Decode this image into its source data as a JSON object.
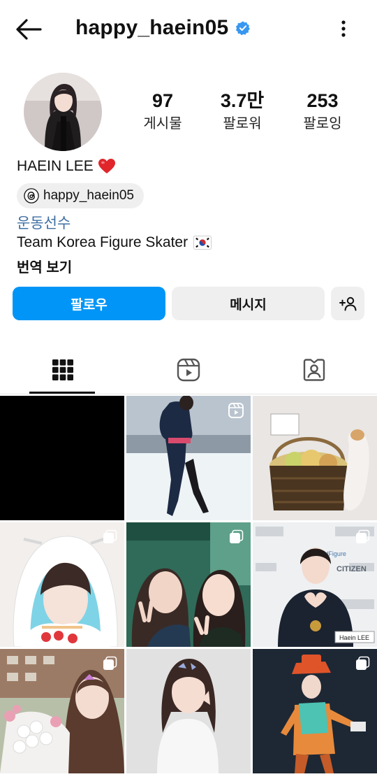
{
  "header": {
    "username": "happy_haein05",
    "verified": true,
    "accent_color": "#3897f0"
  },
  "stats": [
    {
      "value": "97",
      "label": "게시물"
    },
    {
      "value": "3.7만",
      "label": "팔로워"
    },
    {
      "value": "253",
      "label": "팔로잉"
    }
  ],
  "profile": {
    "display_name": "HAEIN LEE",
    "threads_handle": "happy_haein05",
    "category": "운동선수",
    "bio": "Team Korea Figure Skater",
    "translate_label": "번역 보기"
  },
  "actions": {
    "follow_label": "팔로우",
    "message_label": "메시지",
    "follow_color": "#0095f6"
  },
  "tabs": [
    {
      "name": "posts-grid",
      "icon": "grid-icon",
      "active": true
    },
    {
      "name": "reels",
      "icon": "reels-icon",
      "active": false
    },
    {
      "name": "tagged",
      "icon": "tagged-icon",
      "active": false
    }
  ],
  "posts": [
    {
      "type": "photo",
      "icon": "none"
    },
    {
      "type": "reel",
      "icon": "reels-icon"
    },
    {
      "type": "photo",
      "icon": "none"
    },
    {
      "type": "carousel",
      "icon": "carousel-icon"
    },
    {
      "type": "carousel",
      "icon": "carousel-icon"
    },
    {
      "type": "carousel",
      "icon": "carousel-icon"
    },
    {
      "type": "carousel",
      "icon": "carousel-icon"
    },
    {
      "type": "carousel",
      "icon": "carousel-icon"
    },
    {
      "type": "carousel",
      "icon": "carousel-icon"
    }
  ],
  "post_text": {
    "nameplate": "Haein LEE",
    "citizen": "CITIZEN",
    "worldfigure": "#WorldFigure"
  }
}
